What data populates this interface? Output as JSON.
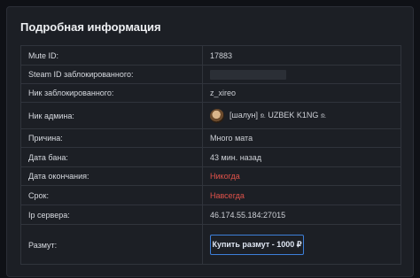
{
  "modal": {
    "title": "Подробная информация"
  },
  "rows": [
    {
      "label": "Mute ID:",
      "value": "17883"
    },
    {
      "label": "Steam ID заблокированного:",
      "value": ""
    },
    {
      "label": "Ник заблокированного:",
      "value": "z_xireo"
    },
    {
      "label": "Ник админа:",
      "value": "[шалун] ௨ UZBEK K1NG ௨"
    },
    {
      "label": "Причина:",
      "value": "Много мата"
    },
    {
      "label": "Дата бана:",
      "value": "43 мин. назад"
    },
    {
      "label": "Дата окончания:",
      "value": "Никогда"
    },
    {
      "label": "Срок:",
      "value": "Навсегда"
    },
    {
      "label": "Ip сервера:",
      "value": "46.174.55.184:27015"
    },
    {
      "label": "Размут:",
      "button": "Купить размут - 1000 ₽"
    }
  ],
  "colors": {
    "accent": "#3d7fd9",
    "danger": "#e0524a"
  },
  "icons": {
    "admin_avatar": "admin-avatar-icon"
  }
}
